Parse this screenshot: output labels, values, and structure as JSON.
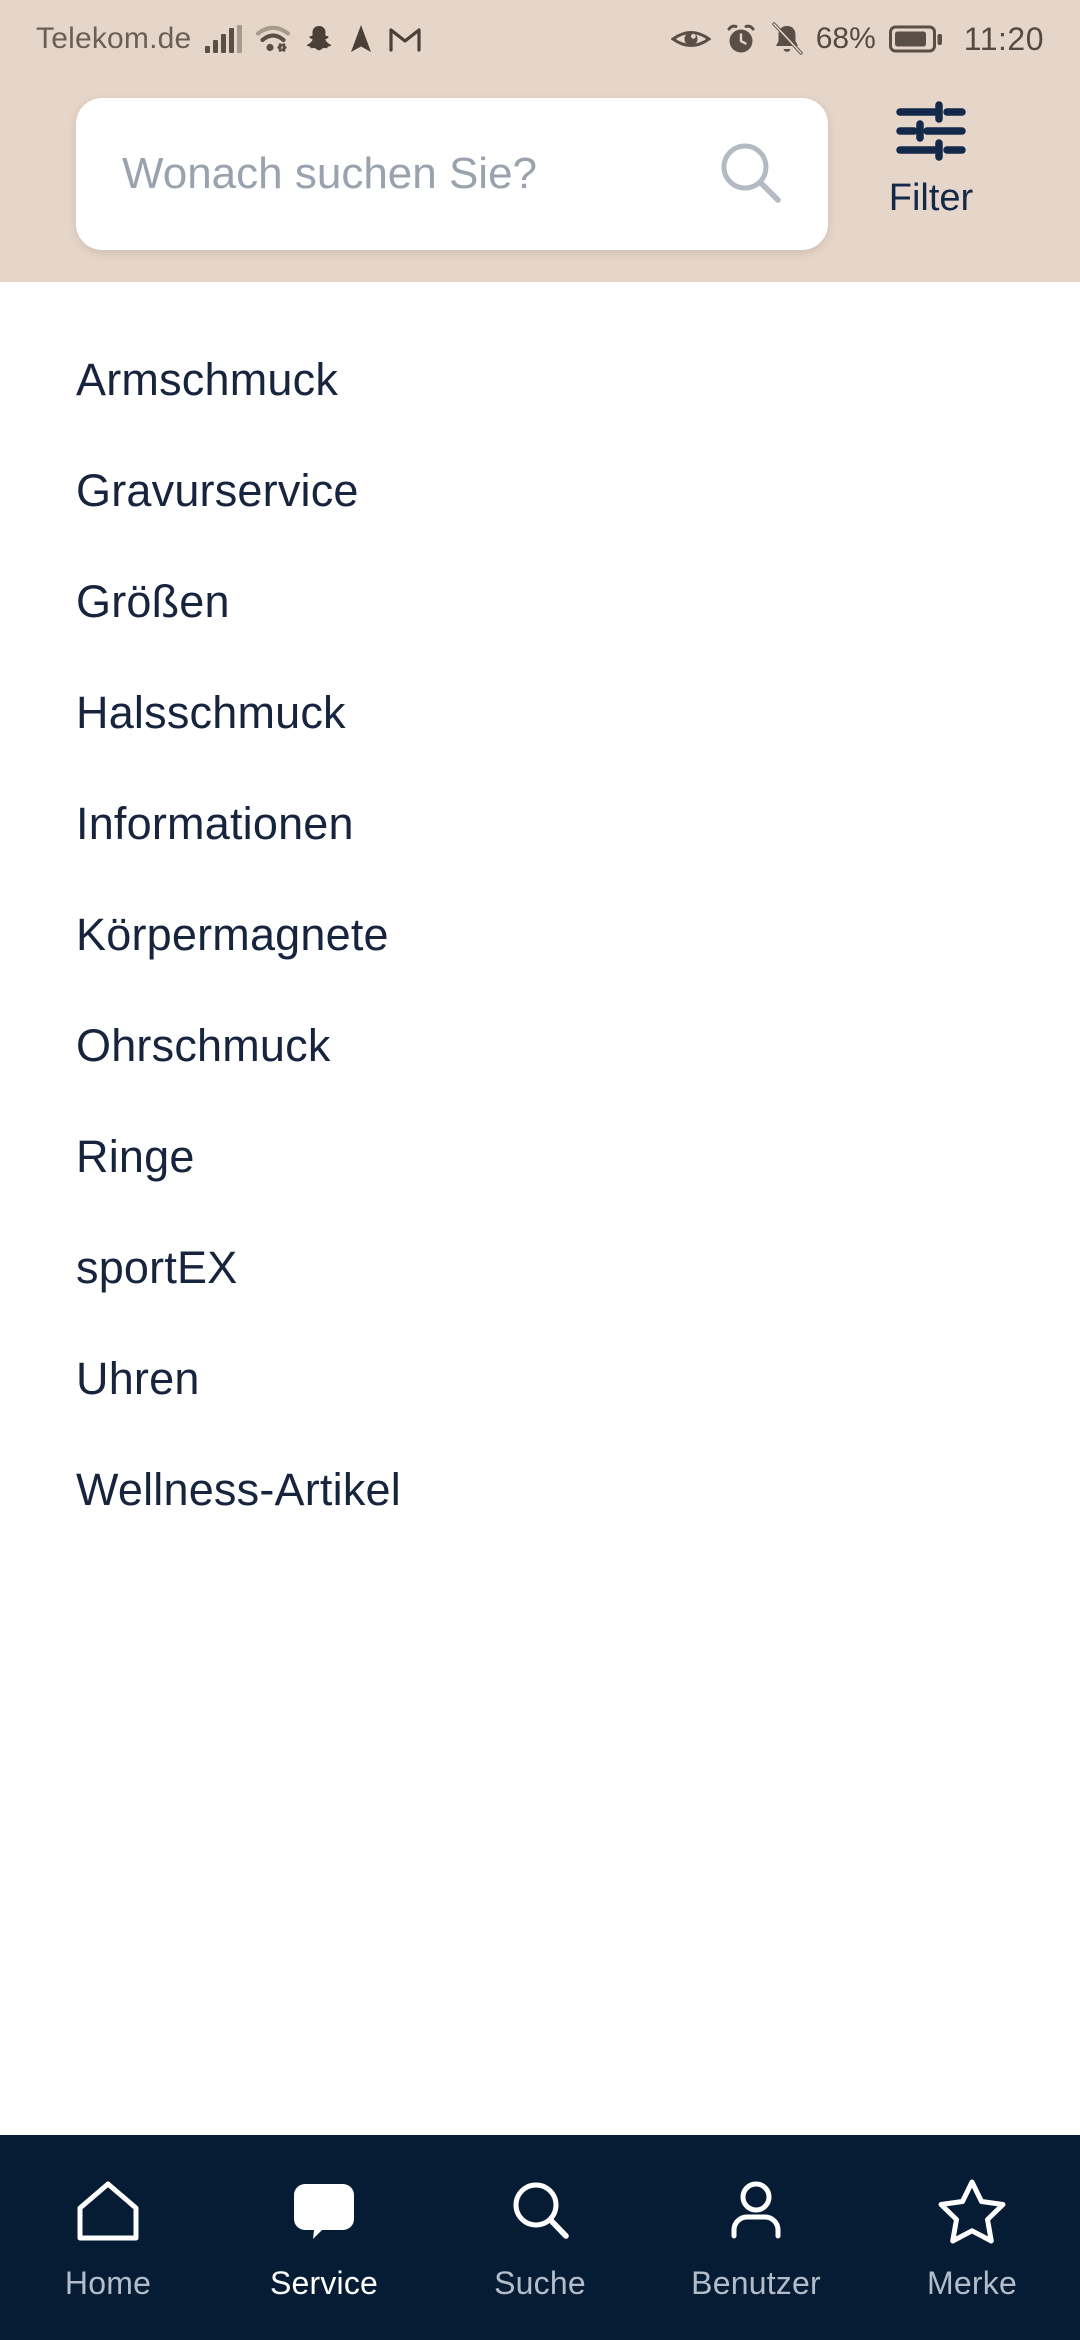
{
  "status_bar": {
    "carrier": "Telekom.de",
    "battery_percent": "68%",
    "time": "11:20",
    "icons": [
      "signal-bars-icon",
      "wifi-icon",
      "snapchat-icon",
      "navigation-arrow-icon",
      "gmail-icon",
      "eye-icon",
      "alarm-clock-icon",
      "bell-muted-icon",
      "battery-icon"
    ]
  },
  "header": {
    "search": {
      "placeholder": "Wonach suchen Sie?",
      "value": "",
      "icon": "search-icon"
    },
    "filter": {
      "label": "Filter",
      "icon": "sliders-icon"
    },
    "background_color": "#e6d6c9"
  },
  "main": {
    "list_items": [
      {
        "label": "Armschmuck"
      },
      {
        "label": "Gravurservice"
      },
      {
        "label": "Größen"
      },
      {
        "label": "Halsschmuck"
      },
      {
        "label": "Informationen"
      },
      {
        "label": "Körpermagnete"
      },
      {
        "label": "Ohrschmuck"
      },
      {
        "label": "Ringe"
      },
      {
        "label": "sportEX"
      },
      {
        "label": "Uhren"
      },
      {
        "label": "Wellness-Artikel"
      }
    ],
    "text_color": "#17243d",
    "background_color": "#ffffff"
  },
  "bottom_nav": {
    "background_color": "#061c35",
    "active_color": "#ffffff",
    "inactive_color": "#b3bcc9",
    "items": [
      {
        "label": "Home",
        "icon": "home-icon",
        "active": false
      },
      {
        "label": "Service",
        "icon": "chat-bubble-icon",
        "active": true
      },
      {
        "label": "Suche",
        "icon": "search-icon",
        "active": false
      },
      {
        "label": "Benutzer",
        "icon": "user-icon",
        "active": false
      },
      {
        "label": "Merke",
        "icon": "star-icon",
        "active": false
      }
    ]
  }
}
